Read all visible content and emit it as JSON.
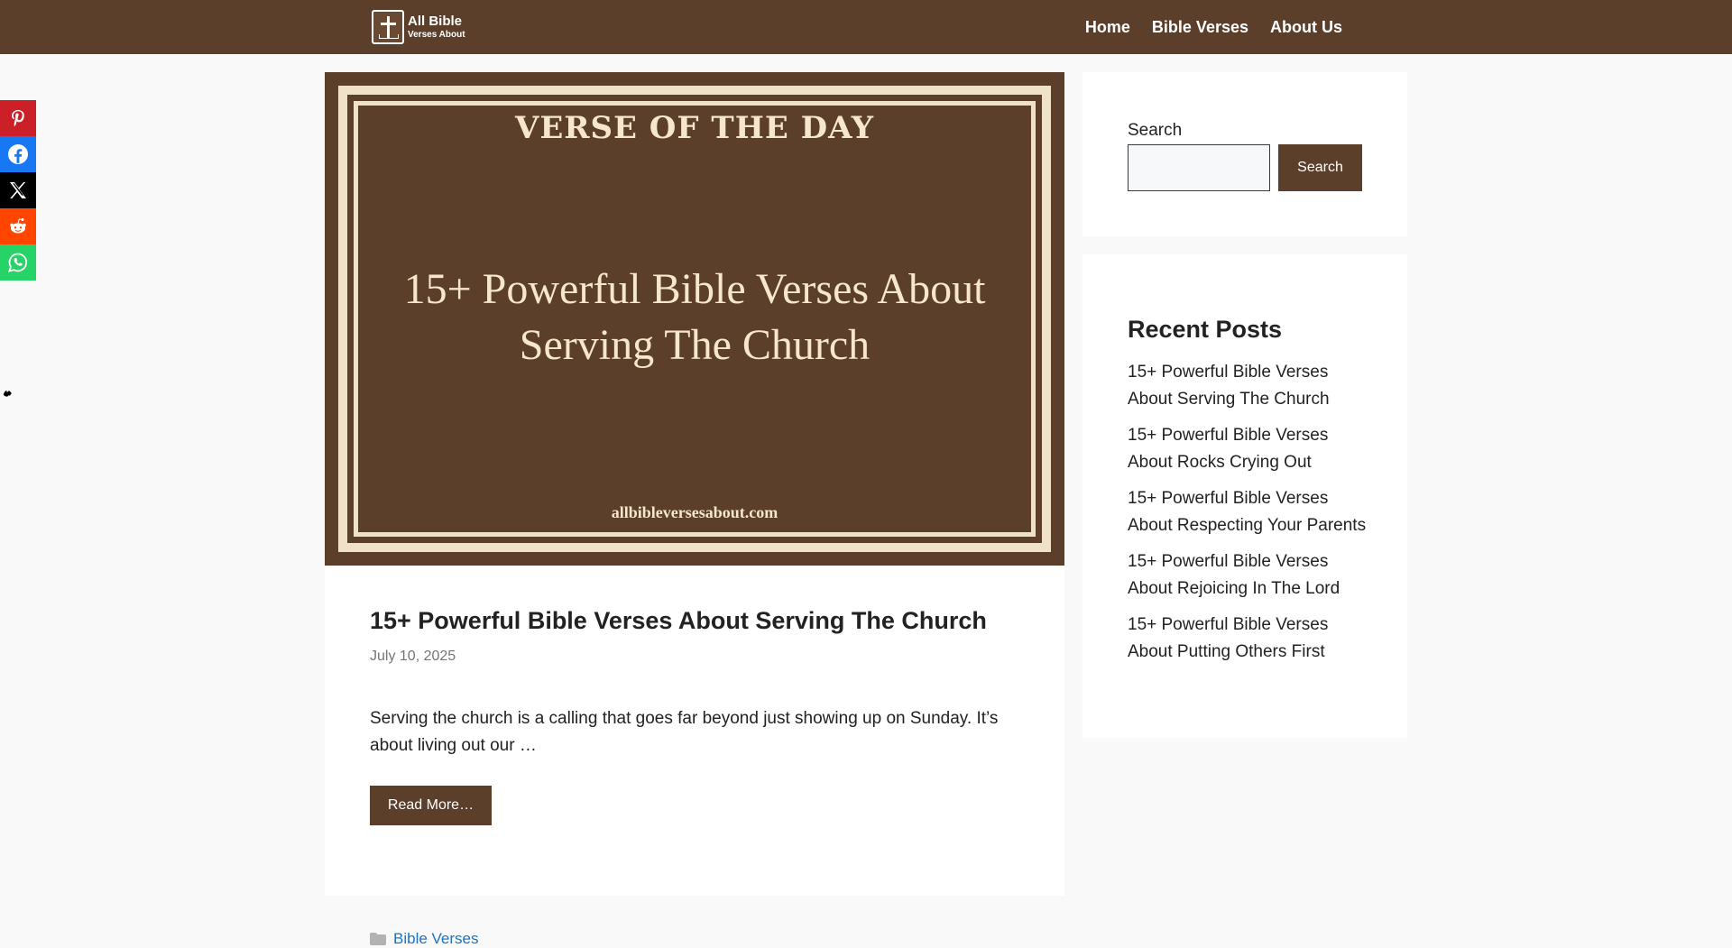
{
  "header": {
    "brand_line1": "All Bible",
    "brand_line2": "Verses About",
    "nav": [
      "Home",
      "Bible Verses",
      "About Us"
    ]
  },
  "share": {
    "items": [
      {
        "name": "Pinterest",
        "color": "#cb2027"
      },
      {
        "name": "Facebook",
        "color": "#1877f2"
      },
      {
        "name": "X",
        "color": "#000000"
      },
      {
        "name": "Reddit",
        "color": "#ff4500"
      },
      {
        "name": "WhatsApp",
        "color": "#25d366"
      }
    ]
  },
  "article": {
    "image": {
      "heading": "VERSE OF THE DAY",
      "title": "15+ Powerful Bible Verses About Serving The Church",
      "site": "allbibleversesabout.com"
    },
    "title": "15+ Powerful Bible Verses About Serving The Church",
    "date": "July 10, 2025",
    "excerpt": "Serving the church is a calling that goes far beyond just showing up on Sunday. It’s about living out our …",
    "read_more": "Read More…",
    "category": "Bible Verses"
  },
  "sidebar": {
    "search_label": "Search",
    "search_button": "Search",
    "recent_title": "Recent Posts",
    "recent_posts": [
      "15+ Powerful Bible Verses About Serving The Church",
      "15+ Powerful Bible Verses About Rocks Crying Out",
      "15+ Powerful Bible Verses About Respecting Your Parents",
      "15+ Powerful Bible Verses About Rejoicing In The Lord",
      "15+ Powerful Bible Verses About Putting Others First"
    ]
  },
  "colors": {
    "brand": "#5c3f2b",
    "link": "#1e73be",
    "background": "#f9f9f9"
  }
}
